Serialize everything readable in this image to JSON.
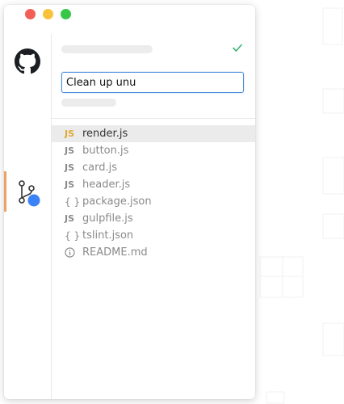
{
  "search": {
    "value": "Clean up unu"
  },
  "files": [
    {
      "icon": "JS",
      "icon_name": "js-icon",
      "name": "render.js",
      "selected": true
    },
    {
      "icon": "JS",
      "icon_name": "js-icon",
      "name": "button.js",
      "selected": false
    },
    {
      "icon": "JS",
      "icon_name": "js-icon",
      "name": "card.js",
      "selected": false
    },
    {
      "icon": "JS",
      "icon_name": "js-icon",
      "name": "header.js",
      "selected": false
    },
    {
      "icon": "{ }",
      "icon_name": "json-icon",
      "name": "package.json",
      "selected": false
    },
    {
      "icon": "JS",
      "icon_name": "js-icon",
      "name": "gulpfile.js",
      "selected": false
    },
    {
      "icon": "{ }",
      "icon_name": "json-icon",
      "name": "tslint.json",
      "selected": false
    },
    {
      "icon": "",
      "icon_name": "info-icon",
      "name": "README.md",
      "selected": false
    }
  ],
  "colors": {
    "accent": "#4a90d9",
    "selected_icon": "#e0a92f",
    "active_indicator": "#f0a060",
    "success": "#3cb371",
    "notification_dot": "#3b82f6"
  },
  "icons": {
    "github": "github-icon",
    "branch": "git-branch-icon",
    "check": "checkmark-icon"
  }
}
